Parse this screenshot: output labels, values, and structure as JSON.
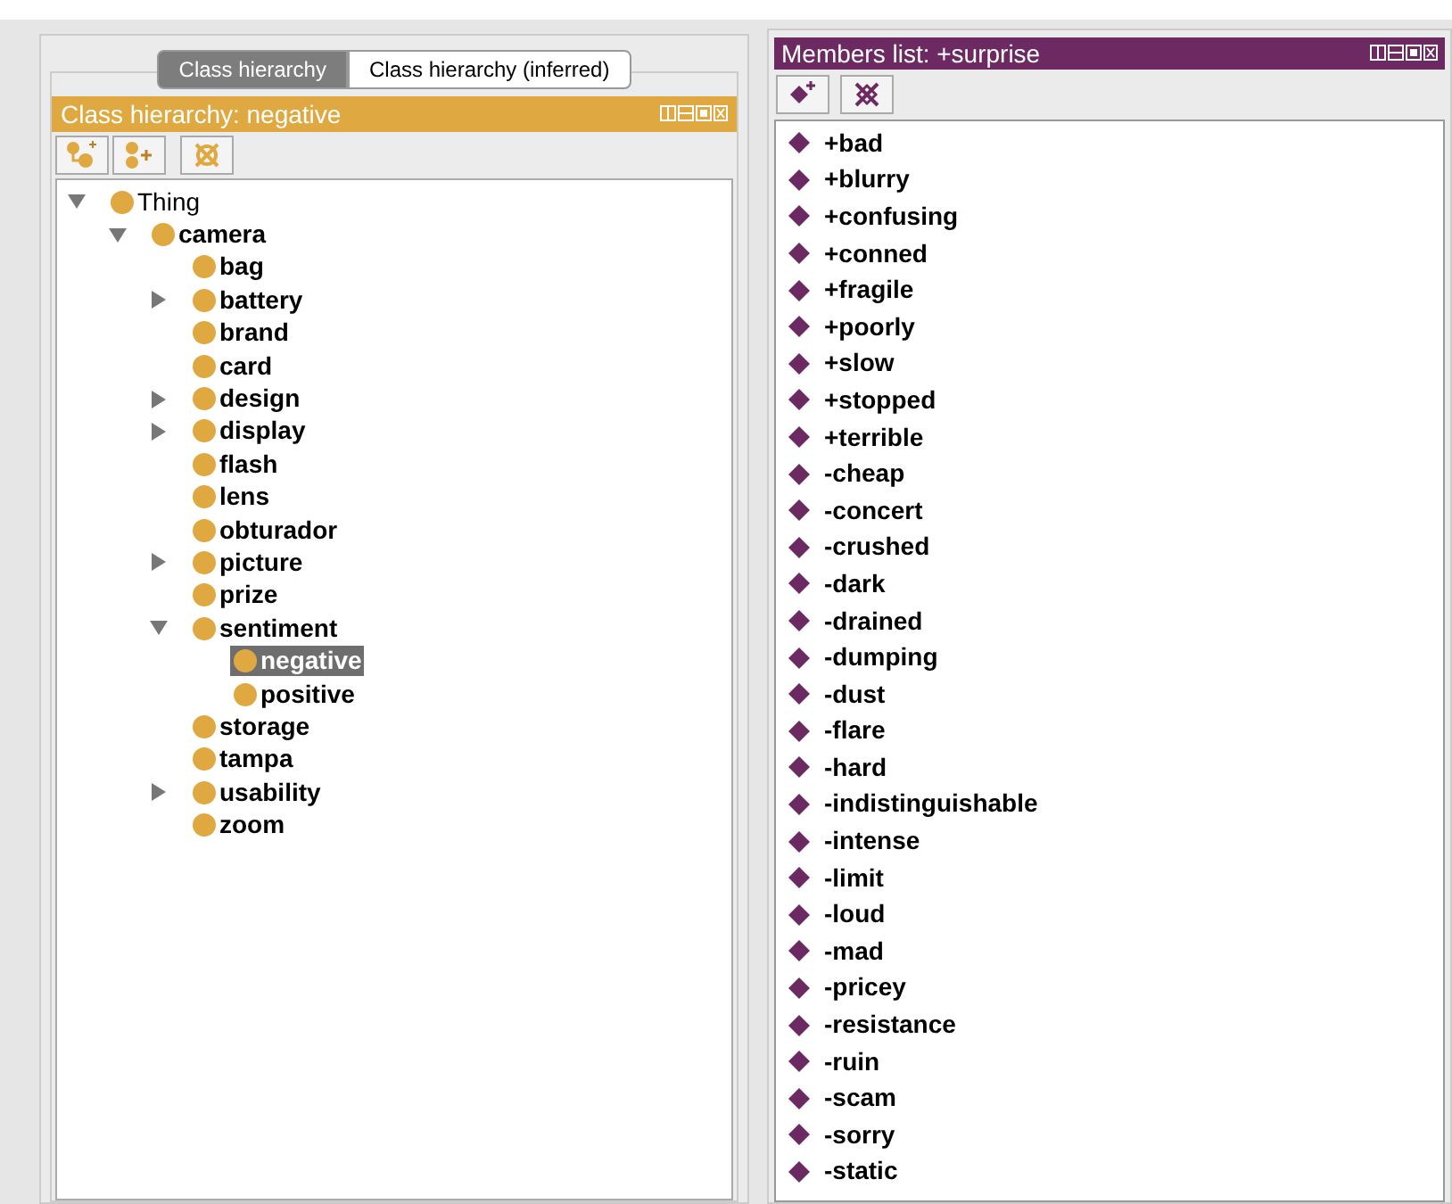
{
  "tabs": [
    {
      "label": "Class hierarchy",
      "selected": true
    },
    {
      "label": "Class hierarchy (inferred)",
      "selected": false
    }
  ],
  "class_panel": {
    "title": "Class hierarchy: negative",
    "tree": [
      {
        "label": "Thing",
        "kind": "root",
        "selected": false,
        "expanded": true,
        "children": [
          {
            "label": "camera",
            "kind": "class",
            "selected": false,
            "expanded": true,
            "children": [
              {
                "label": "bag",
                "kind": "class",
                "selected": false
              },
              {
                "label": "battery",
                "kind": "class",
                "selected": false,
                "expanded": false
              },
              {
                "label": "brand",
                "kind": "class",
                "selected": false
              },
              {
                "label": "card",
                "kind": "class",
                "selected": false
              },
              {
                "label": "design",
                "kind": "class",
                "selected": false,
                "expanded": false
              },
              {
                "label": "display",
                "kind": "class",
                "selected": false,
                "expanded": false
              },
              {
                "label": "flash",
                "kind": "class",
                "selected": false
              },
              {
                "label": "lens",
                "kind": "class",
                "selected": false
              },
              {
                "label": "obturador",
                "kind": "class",
                "selected": false
              },
              {
                "label": "picture",
                "kind": "class",
                "selected": false,
                "expanded": false
              },
              {
                "label": "prize",
                "kind": "class",
                "selected": false
              },
              {
                "label": "sentiment",
                "kind": "class",
                "selected": false,
                "expanded": true,
                "children": [
                  {
                    "label": "negative",
                    "kind": "class",
                    "selected": true
                  },
                  {
                    "label": "positive",
                    "kind": "class",
                    "selected": false
                  }
                ]
              },
              {
                "label": "storage",
                "kind": "class",
                "selected": false
              },
              {
                "label": "tampa",
                "kind": "class",
                "selected": false
              },
              {
                "label": "usability",
                "kind": "class",
                "selected": false,
                "expanded": false
              },
              {
                "label": "zoom",
                "kind": "class",
                "selected": false
              }
            ]
          }
        ]
      }
    ]
  },
  "members_panel": {
    "title": "Members list: +surprise",
    "members": [
      "+bad",
      "+blurry",
      "+confusing",
      "+conned",
      "+fragile",
      "+poorly",
      "+slow",
      "+stopped",
      "+terrible",
      "-cheap",
      "-concert",
      "-crushed",
      "-dark",
      "-drained",
      "-dumping",
      "-dust",
      "-flare",
      "-hard",
      "-indistinguishable",
      "-intense",
      "-limit",
      "-loud",
      "-mad",
      "-pricey",
      "-resistance",
      "-ruin",
      "-scam",
      "-sorry",
      "-static"
    ]
  }
}
